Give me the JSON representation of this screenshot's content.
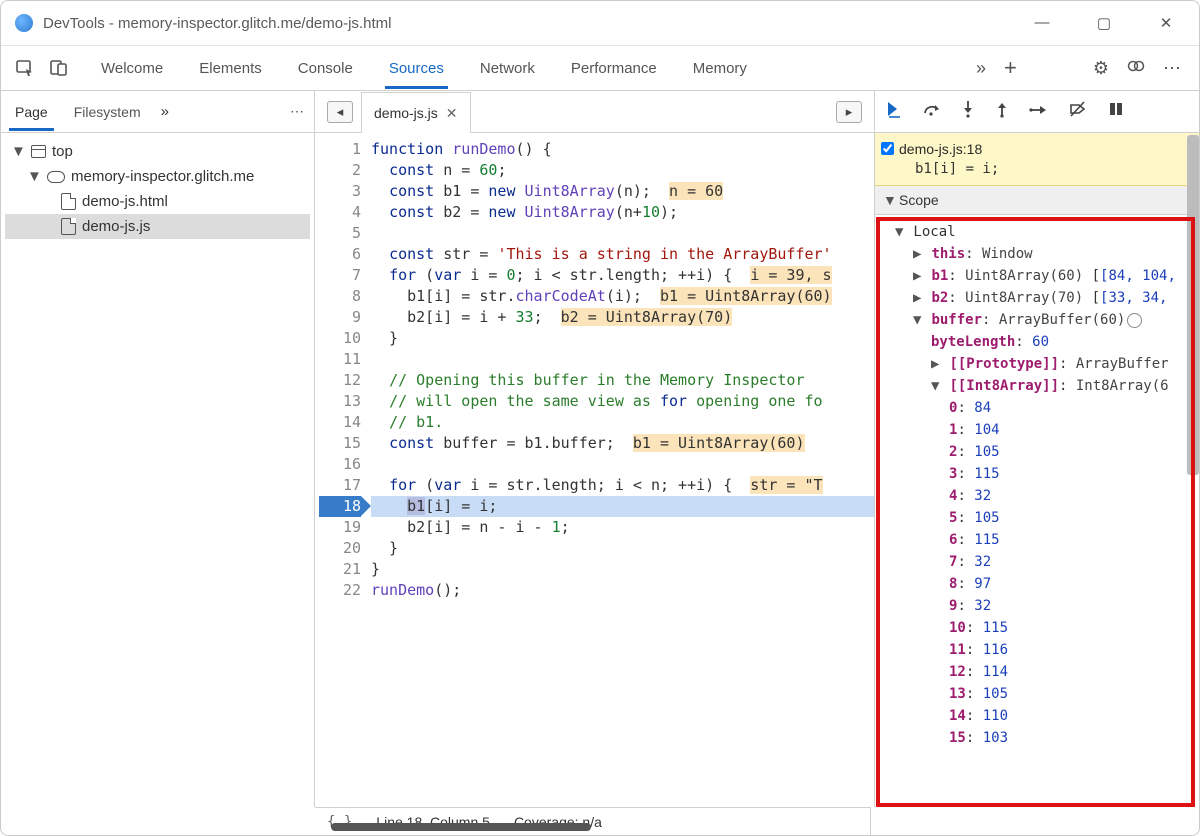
{
  "window": {
    "title": "DevTools - memory-inspector.glitch.me/demo-js.html"
  },
  "main_tabs": [
    "Welcome",
    "Elements",
    "Console",
    "Sources",
    "Network",
    "Performance",
    "Memory"
  ],
  "main_tabs_active": "Sources",
  "left_tabs": [
    "Page",
    "Filesystem"
  ],
  "left_tabs_active": "Page",
  "file_tree": {
    "top": "top",
    "domain": "memory-inspector.glitch.me",
    "files": [
      "demo-js.html",
      "demo-js.js"
    ],
    "selected": "demo-js.js"
  },
  "open_file_tab": "demo-js.js",
  "code_lines": [
    "function runDemo() {",
    "  const n = 60;",
    "  const b1 = new Uint8Array(n);  |n = 60|",
    "  const b2 = new Uint8Array(n+10);",
    "",
    "  const str = 'This is a string in the ArrayBuffer'",
    "  for (var i = 0; i < str.length; ++i) { |i = 39, s|",
    "    b1[i] = str.charCodeAt(i);  |b1 = Uint8Array(60)|",
    "    b2[i] = i + 33;  |b2 = Uint8Array(70)|",
    "  }",
    "",
    "  // Opening this buffer in the Memory Inspector",
    "  // will open the same view as for opening one fo",
    "  // b1.",
    "  const buffer = b1.buffer;  |b1 = Uint8Array(60)|",
    "",
    "  for (var i = str.length; i < n; ++i) { |str = \"T|",
    "    b1[i] = i;",
    "    b2[i] = n - i - 1;",
    "  }",
    "}",
    "runDemo();"
  ],
  "exec_line": 18,
  "breakpoint": {
    "file": "demo-js.js:18",
    "code": "b1[i] = i;"
  },
  "scope": {
    "header": "Scope",
    "local_label": "Local",
    "this": {
      "label": "this",
      "value": "Window"
    },
    "b1": {
      "label": "b1",
      "type": "Uint8Array(60)",
      "preview": "[84, 104,"
    },
    "b2": {
      "label": "b2",
      "type": "Uint8Array(70)",
      "preview": "[33, 34,"
    },
    "buffer": {
      "label": "buffer",
      "type": "ArrayBuffer(60)",
      "byteLength_label": "byteLength",
      "byteLength": 60,
      "proto_label": "[[Prototype]]",
      "proto_value": "ArrayBuffer",
      "int8_label": "[[Int8Array]]",
      "int8_value": "Int8Array(6",
      "int8_items": [
        84,
        104,
        105,
        115,
        32,
        105,
        115,
        32,
        97,
        32,
        115,
        116,
        114,
        105,
        110,
        103
      ]
    }
  },
  "status": {
    "pos": "Line 18, Column 5",
    "coverage": "Coverage: n/a"
  }
}
